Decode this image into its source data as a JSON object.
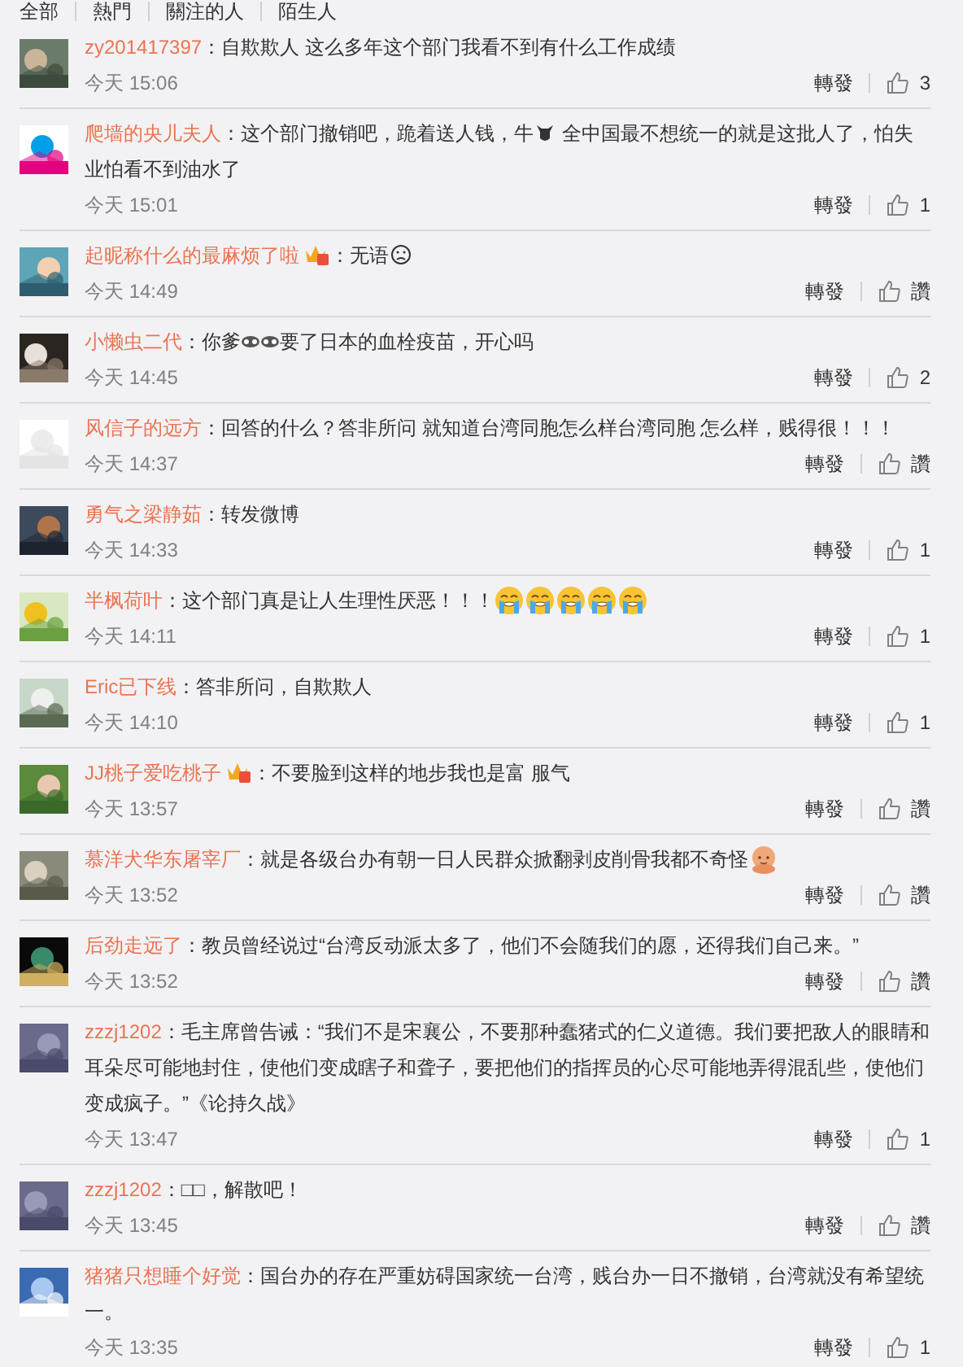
{
  "tabs": [
    {
      "label": "全部",
      "selected": false
    },
    {
      "label": "熱門",
      "selected": false
    },
    {
      "label": "關注的人",
      "selected": false
    },
    {
      "label": "陌生人",
      "selected": false
    }
  ],
  "comments": [
    {
      "user": "zy201417397",
      "vip": false,
      "parts": [
        {
          "kind": "text",
          "text": "：自欺欺人 这么多年这个部门我看不到有什么工作成绩"
        }
      ],
      "time": "今天 15:06",
      "repost": "轉發",
      "likes": "3"
    },
    {
      "user": "爬墙的央儿夫人",
      "vip": false,
      "parts": [
        {
          "kind": "text",
          "text": "：这个部门撤销吧，跪着送人钱，牛"
        },
        {
          "kind": "cow"
        },
        {
          "kind": "text",
          "text": " 全中国最不想统一的就是这批人了，怕失业怕看不到油水了"
        }
      ],
      "time": "今天 15:01",
      "repost": "轉發",
      "likes": "1"
    },
    {
      "user": "起昵称什么的最麻烦了啦",
      "vip": true,
      "parts": [
        {
          "kind": "text",
          "text": "：无语"
        },
        {
          "kind": "frown"
        }
      ],
      "time": "今天 14:49",
      "repost": "轉發",
      "likes": "讚"
    },
    {
      "user": "小懒虫二代",
      "vip": false,
      "parts": [
        {
          "kind": "text",
          "text": "：你爹"
        },
        {
          "kind": "mask"
        },
        {
          "kind": "mask"
        },
        {
          "kind": "text",
          "text": "要了日本的血栓疫苗，开心吗"
        }
      ],
      "time": "今天 14:45",
      "repost": "轉發",
      "likes": "2"
    },
    {
      "user": "风信子的远方",
      "vip": false,
      "parts": [
        {
          "kind": "text",
          "text": "：回答的什么？答非所问   就知道台湾同胞怎么样台湾同胞 怎么样，贱得很！！！"
        }
      ],
      "time": "今天 14:37",
      "repost": "轉發",
      "likes": "讚"
    },
    {
      "user": "勇气之梁静茹",
      "vip": false,
      "parts": [
        {
          "kind": "text",
          "text": "：转发微博"
        }
      ],
      "time": "今天 14:33",
      "repost": "轉發",
      "likes": "1"
    },
    {
      "user": "半枫荷叶",
      "vip": false,
      "parts": [
        {
          "kind": "text",
          "text": "：这个部门真是让人生理性厌恶！！！"
        },
        {
          "kind": "cry"
        },
        {
          "kind": "cry"
        },
        {
          "kind": "cry"
        },
        {
          "kind": "cry"
        },
        {
          "kind": "cry"
        }
      ],
      "time": "今天 14:11",
      "repost": "轉發",
      "likes": "1"
    },
    {
      "user": "Eric已下线",
      "vip": false,
      "parts": [
        {
          "kind": "text",
          "text": "：答非所问，自欺欺人"
        }
      ],
      "time": "今天 14:10",
      "repost": "轉發",
      "likes": "1"
    },
    {
      "user": "JJ桃子爱吃桃子",
      "vip": true,
      "parts": [
        {
          "kind": "text",
          "text": "：不要脸到这样的地步我也是富 服气"
        }
      ],
      "time": "今天 13:57",
      "repost": "轉發",
      "likes": "讚"
    },
    {
      "user": "慕洋犬华东屠宰厂",
      "vip": false,
      "parts": [
        {
          "kind": "text",
          "text": "：就是各级台办有朝一日人民群众掀翻剥皮削骨我都不奇怪"
        },
        {
          "kind": "doll"
        }
      ],
      "time": "今天 13:52",
      "repost": "轉發",
      "likes": "讚"
    },
    {
      "user": "后劲走远了",
      "vip": false,
      "parts": [
        {
          "kind": "text",
          "text": "：教员曾经说过“台湾反动派太多了，他们不会随我们的愿，还得我们自己来。”"
        }
      ],
      "time": "今天 13:52",
      "repost": "轉發",
      "likes": "讚"
    },
    {
      "user": "zzzj1202",
      "vip": false,
      "parts": [
        {
          "kind": "text",
          "text": "：毛主席曾告诫：“我们不是宋襄公，不要那种蠢猪式的仁义道德。我们要把敌人的眼睛和耳朵尽可能地封住，使他们变成瞎子和聋子，要把他们的指挥员的心尽可能地弄得混乱些，使他们变成疯子。”《论持久战》"
        }
      ],
      "time": "今天 13:47",
      "repost": "轉發",
      "likes": "1"
    },
    {
      "user": "zzzj1202",
      "vip": false,
      "parts": [
        {
          "kind": "text",
          "text": "：□□，解散吧！"
        }
      ],
      "time": "今天 13:45",
      "repost": "轉發",
      "likes": "讚"
    },
    {
      "user": "猪猪只想睡个好觉",
      "vip": false,
      "parts": [
        {
          "kind": "text",
          "text": "：国台办的存在严重妨碍国家统一台湾，贱台办一日不撤销，台湾就没有希望统一。"
        }
      ],
      "time": "今天 13:35",
      "repost": "轉發",
      "likes": "1"
    }
  ]
}
